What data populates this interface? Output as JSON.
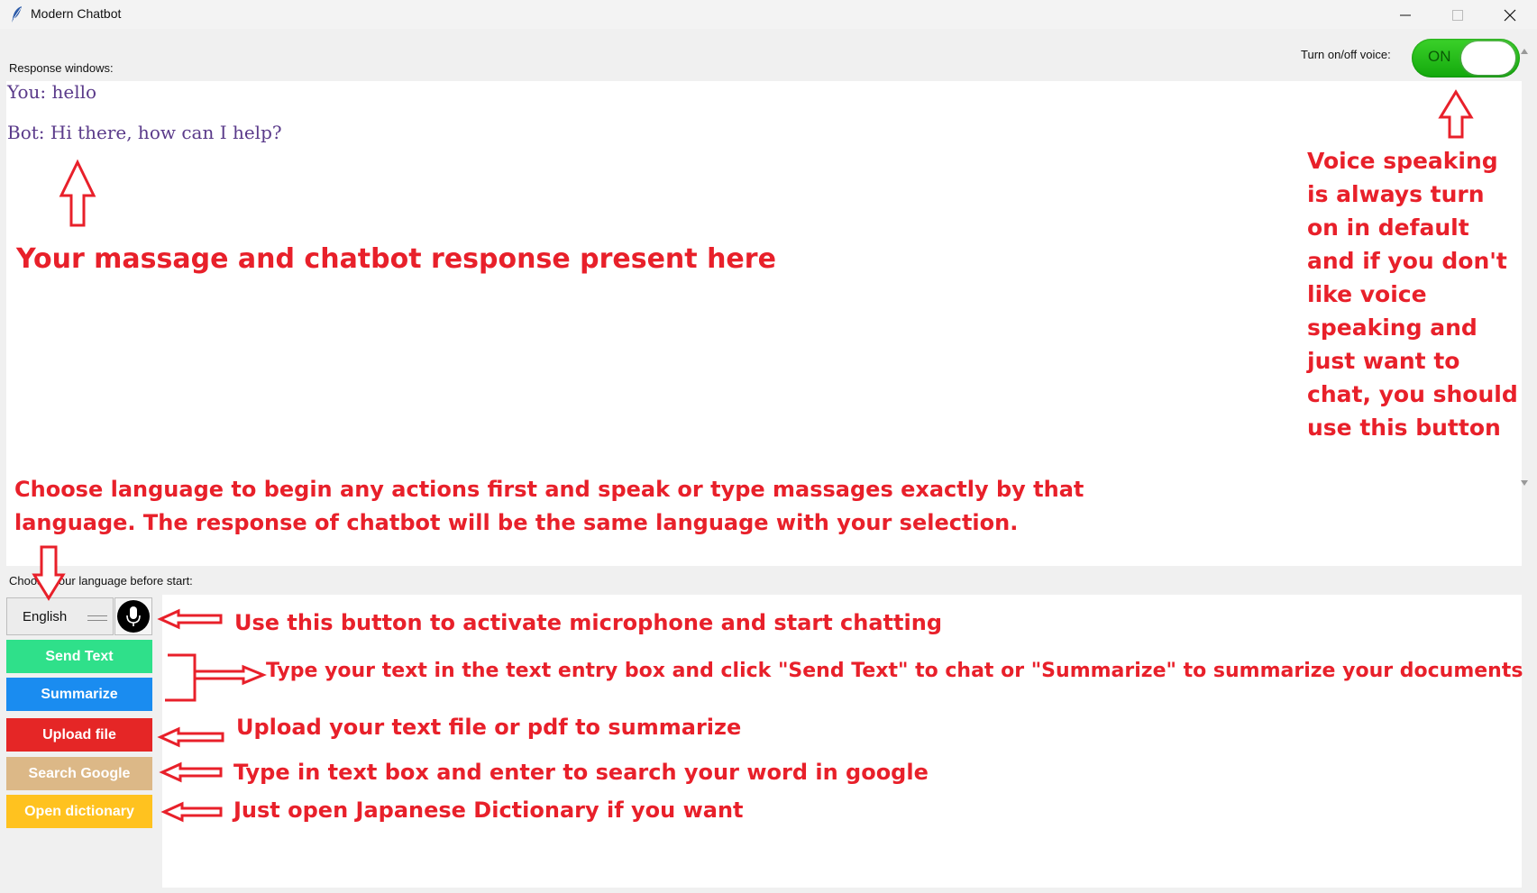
{
  "window": {
    "title": "Modern Chatbot",
    "controls": {
      "minimize": "minimize-icon",
      "maximize": "maximize-icon",
      "close": "close-icon"
    }
  },
  "voice_toggle": {
    "label": "Turn on/off voice:",
    "state": "ON",
    "on_color": "#1db814"
  },
  "response": {
    "label": "Response windows:",
    "messages": [
      "You: hello",
      "Bot: Hi there, how can I help?"
    ]
  },
  "language": {
    "label": "Choose your language before start:",
    "selected": "English"
  },
  "buttons": {
    "send_text": "Send Text",
    "summarize": "Summarize",
    "upload_file": "Upload file",
    "search_google": "Search Google",
    "open_dictionary": "Open dictionary"
  },
  "colors": {
    "send_text": "#2fe08a",
    "summarize": "#1a8cf0",
    "upload_file": "#e52626",
    "search_google": "#dcb887",
    "open_dictionary": "#ffc21f",
    "annotation": "#e8202a",
    "chat_text": "#5a3a8a"
  },
  "annotations": {
    "response_area": "Your massage and chatbot response present here",
    "voice": "Voice speaking is always turn on in default and if you don't like voice speaking and just want to chat, you should use this button",
    "language_line1": "Choose language to begin any actions first and speak or type massages exactly by that",
    "language_line2": "language. The response of chatbot will be the same language with your selection.",
    "microphone": "Use this button to activate microphone and start chatting",
    "send_summarize": "Type your text in the text entry box and click \"Send Text\" to chat or \"Summarize\" to summarize your documents",
    "upload": "Upload your text file or pdf to summarize",
    "search": "Type in text box and enter to search your word in google",
    "dictionary": "Just open Japanese Dictionary if you want"
  }
}
